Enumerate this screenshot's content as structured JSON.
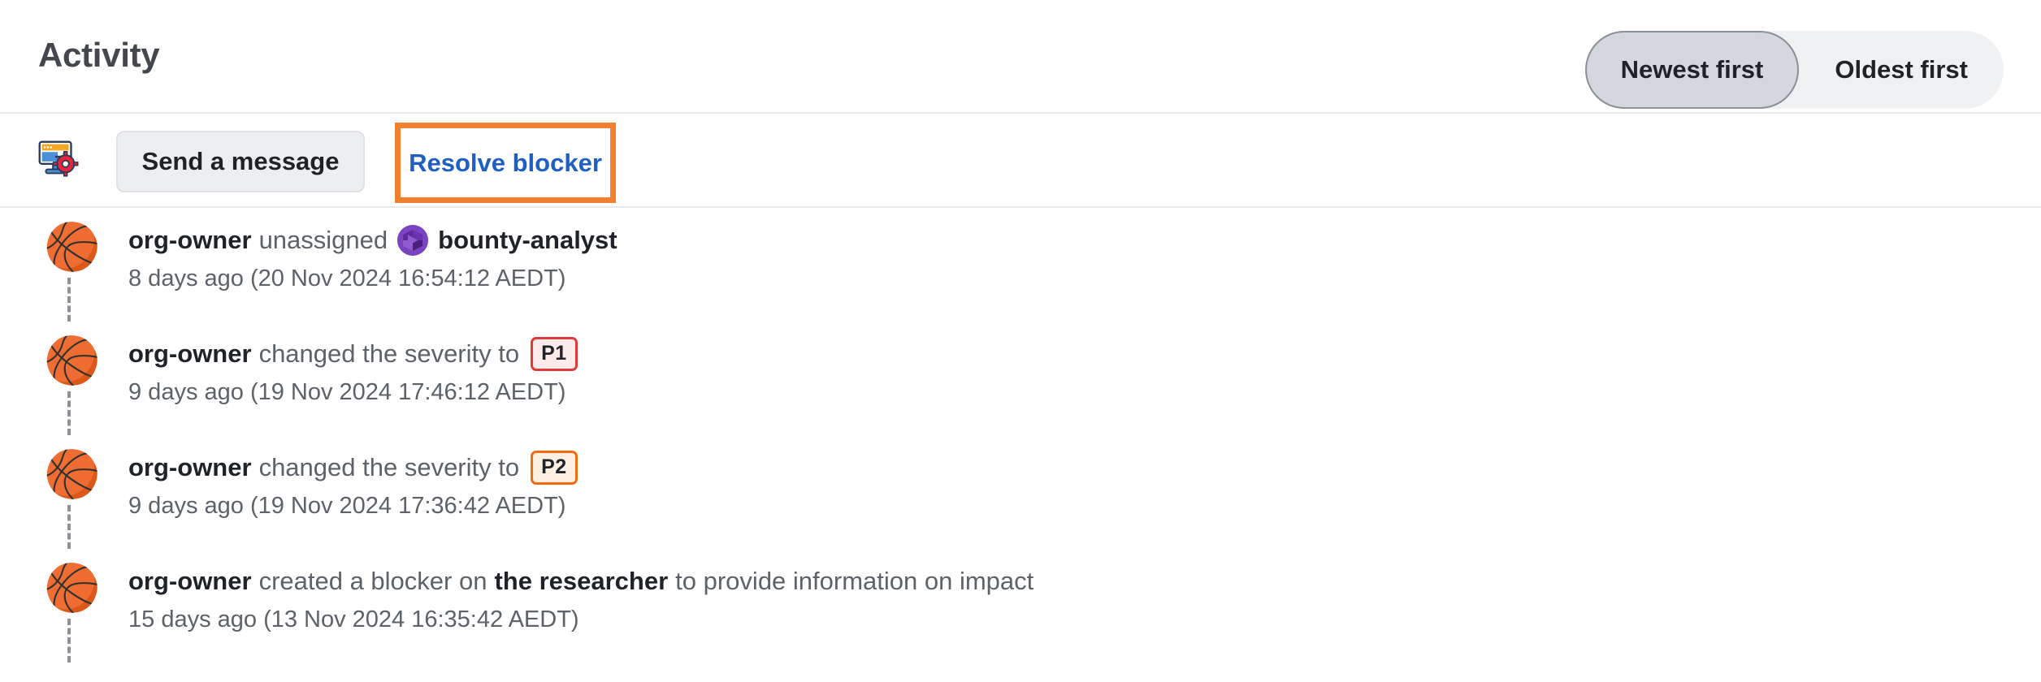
{
  "header": {
    "title": "Activity",
    "sort": {
      "options": [
        {
          "label": "Newest first",
          "selected": true
        },
        {
          "label": "Oldest first",
          "selected": false
        }
      ]
    }
  },
  "actions": {
    "actor_icon": "desktop-computer-gear-icon",
    "actor_icon_glyph": "🖥️",
    "send_message_label": "Send a message",
    "resolve_blocker_label": "Resolve blocker",
    "resolve_blocker_color": "#1f5fc4",
    "highlight_color": "#f08030"
  },
  "timeline": {
    "avatar_glyph": "🏀",
    "items": [
      {
        "actor": "org-owner",
        "action": "unassigned",
        "inline_avatar": "bounty-analyst-avatar",
        "inline_avatar_color": "#7a43c0",
        "target": "bounty-analyst",
        "tail": "",
        "badge": null,
        "timestamp": "8 days ago (20 Nov 2024 16:54:12 AEDT)"
      },
      {
        "actor": "org-owner",
        "action": "changed the severity to",
        "inline_avatar": null,
        "target": "",
        "tail": "",
        "badge": {
          "label": "P1",
          "class": "sev-p1",
          "border": "#e03a3a",
          "background": "#fdeaea"
        },
        "timestamp": "9 days ago (19 Nov 2024 17:46:12 AEDT)"
      },
      {
        "actor": "org-owner",
        "action": "changed the severity to",
        "inline_avatar": null,
        "target": "",
        "tail": "",
        "badge": {
          "label": "P2",
          "class": "sev-p2",
          "border": "#ef6c12",
          "background": "#fdf0e2"
        },
        "timestamp": "9 days ago (19 Nov 2024 17:36:42 AEDT)"
      },
      {
        "actor": "org-owner",
        "action": "created a blocker on",
        "inline_avatar": null,
        "target": "the researcher",
        "tail": "to provide information on impact",
        "badge": null,
        "timestamp": "15 days ago (13 Nov 2024 16:35:42 AEDT)"
      }
    ]
  }
}
